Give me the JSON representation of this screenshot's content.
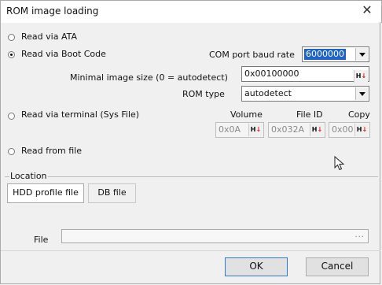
{
  "window": {
    "title": "ROM image loading"
  },
  "read_mode": {
    "ata": "Read via ATA",
    "boot_code": "Read via Boot Code",
    "terminal": "Read via terminal (Sys File)",
    "file": "Read from file",
    "selected": "boot_code"
  },
  "com_port": {
    "label": "COM port baud rate",
    "value": "6000000"
  },
  "image_size": {
    "label": "Minimal image size (0 = autodetect)",
    "value": "0x00100000"
  },
  "rom_type": {
    "label": "ROM type",
    "value": "autodetect"
  },
  "terminal": {
    "volume_label": "Volume",
    "volume_value": "0x0A",
    "file_id_label": "File ID",
    "file_id_value": "0x032A",
    "copy_label": "Copy",
    "copy_value": "0x00"
  },
  "hex_button": {
    "prefix": "H",
    "arrow": "↓"
  },
  "location": {
    "label": "Location",
    "tabs": [
      "HDD profile file",
      "DB file"
    ],
    "file_label": "File",
    "file_value": "",
    "browse": "..."
  },
  "buttons": {
    "ok": "OK",
    "cancel": "Cancel"
  }
}
